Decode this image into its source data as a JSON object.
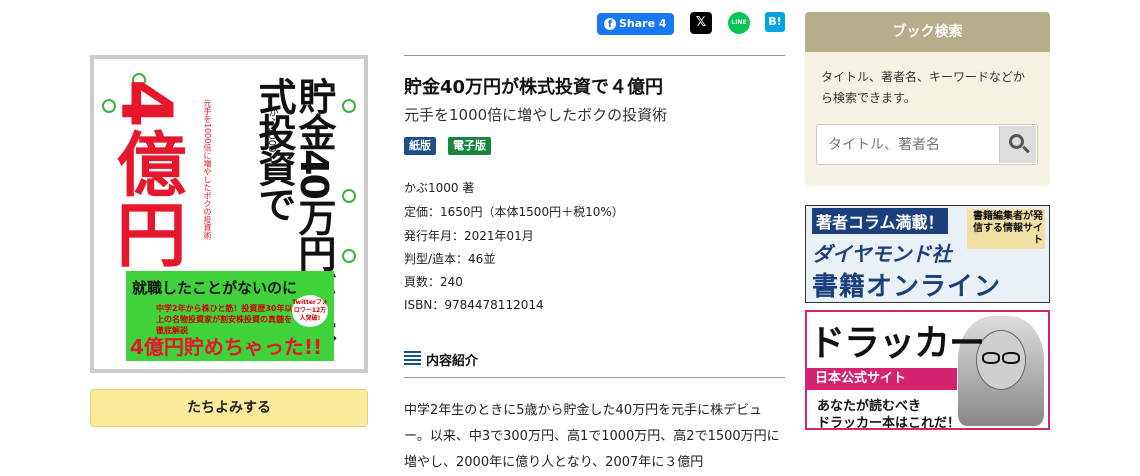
{
  "share": {
    "facebook_label": "Share",
    "facebook_count": "4",
    "x_glyph": "𝕏",
    "line_label": "LINE",
    "hatena_label": "B!"
  },
  "book": {
    "cover": {
      "big": "4億円",
      "title": "貯金40万円が株式投資で",
      "subtitle": "元手を1000倍に増やしたボクの投資術",
      "author": "かぶ1000",
      "band_line1": "就職したことがないのに",
      "band_line2": "中学2年から株ひと筋！投資歴30年以上の名物投資家が割安株投資の真髄を徹底解説",
      "band_line3": "4億円貯めちゃった!!",
      "badge": "Twitterフォロワー12万人突破!"
    },
    "tachiyomi_label": "たちよみする",
    "title": "貯金40万円が株式投資で４億円",
    "subtitle": "元手を1000倍に増やしたボクの投資術",
    "badge_paper": "紙版",
    "badge_ebook": "電子版",
    "meta": [
      "かぶ1000 著",
      "定価：1650円（本体1500円＋税10%）",
      "発行年月：2021年01月",
      "判型/造本：46並",
      "頁数：240",
      "ISBN：9784478112014"
    ],
    "section_title": "内容紹介",
    "description": "中学2年生のときに5歳から貯金した40万円を元手に株デビュー。以来、中3で300万円、高1で1000万円、高2で1500万円に増やし、2000年に億り人となり、2007年に３億円"
  },
  "search": {
    "heading": "ブック検索",
    "description": "タイトル、著者名、キーワードなどから検索できます。",
    "placeholder": "タイトル、著者名",
    "button_icon": "search-icon"
  },
  "banner1": {
    "top": "著者コラム満載！",
    "side": "書籍編集者が発信する情報サイト",
    "brand": "ダイヤモンド社",
    "main": "書籍オンライン"
  },
  "banner2": {
    "title": "ドラッカー",
    "pink": "日本公式サイト",
    "line1": "あなたが読むべき",
    "line2": "ドラッカー本はこれだ！"
  },
  "colors": {
    "accent_paper": "#1b4f8c",
    "accent_ebook": "#14863d",
    "tachiyomi_bg": "#fbeb9b",
    "search_head": "#b6ad8a",
    "drucker_pink": "#d4246f"
  }
}
